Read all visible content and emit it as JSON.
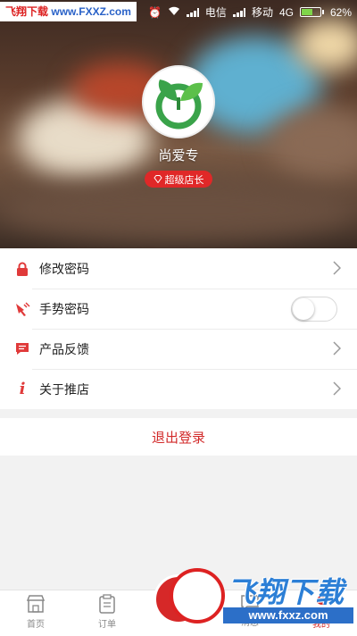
{
  "status_bar": {
    "watermark_text_red": "飞翔下载",
    "watermark_text_blue": "www.FXXZ.com",
    "carrier1": "电信",
    "carrier2": "移动",
    "network": "4G",
    "battery": "62%",
    "battery_level": 0.62
  },
  "profile": {
    "shop_name": "尚爱专",
    "badge": "超级店长",
    "avatar_icon": "sprout-logo-icon"
  },
  "menu": {
    "items": [
      {
        "label": "修改密码",
        "icon": "lock-icon",
        "control": "chevron"
      },
      {
        "label": "手势密码",
        "icon": "hand-icon",
        "control": "toggle",
        "enabled": false
      },
      {
        "label": "产品反馈",
        "icon": "feedback-icon",
        "control": "chevron"
      },
      {
        "label": "关于推店",
        "icon": "info-icon",
        "control": "chevron"
      }
    ]
  },
  "logout_label": "退出登录",
  "tabs": [
    {
      "label": "首页",
      "icon": "store-icon",
      "active": false
    },
    {
      "label": "订单",
      "icon": "order-icon",
      "active": false
    },
    {
      "label": "消息",
      "icon": "message-icon",
      "active": false
    },
    {
      "label": "我的",
      "icon": "profile-icon",
      "active": true
    }
  ],
  "watermark": {
    "brand": "飞翔下载",
    "url": "www.fxxz.com"
  },
  "colors": {
    "accent": "#e02828",
    "brand_green": "#3aa34a",
    "watermark_blue": "#2c7fd6"
  }
}
